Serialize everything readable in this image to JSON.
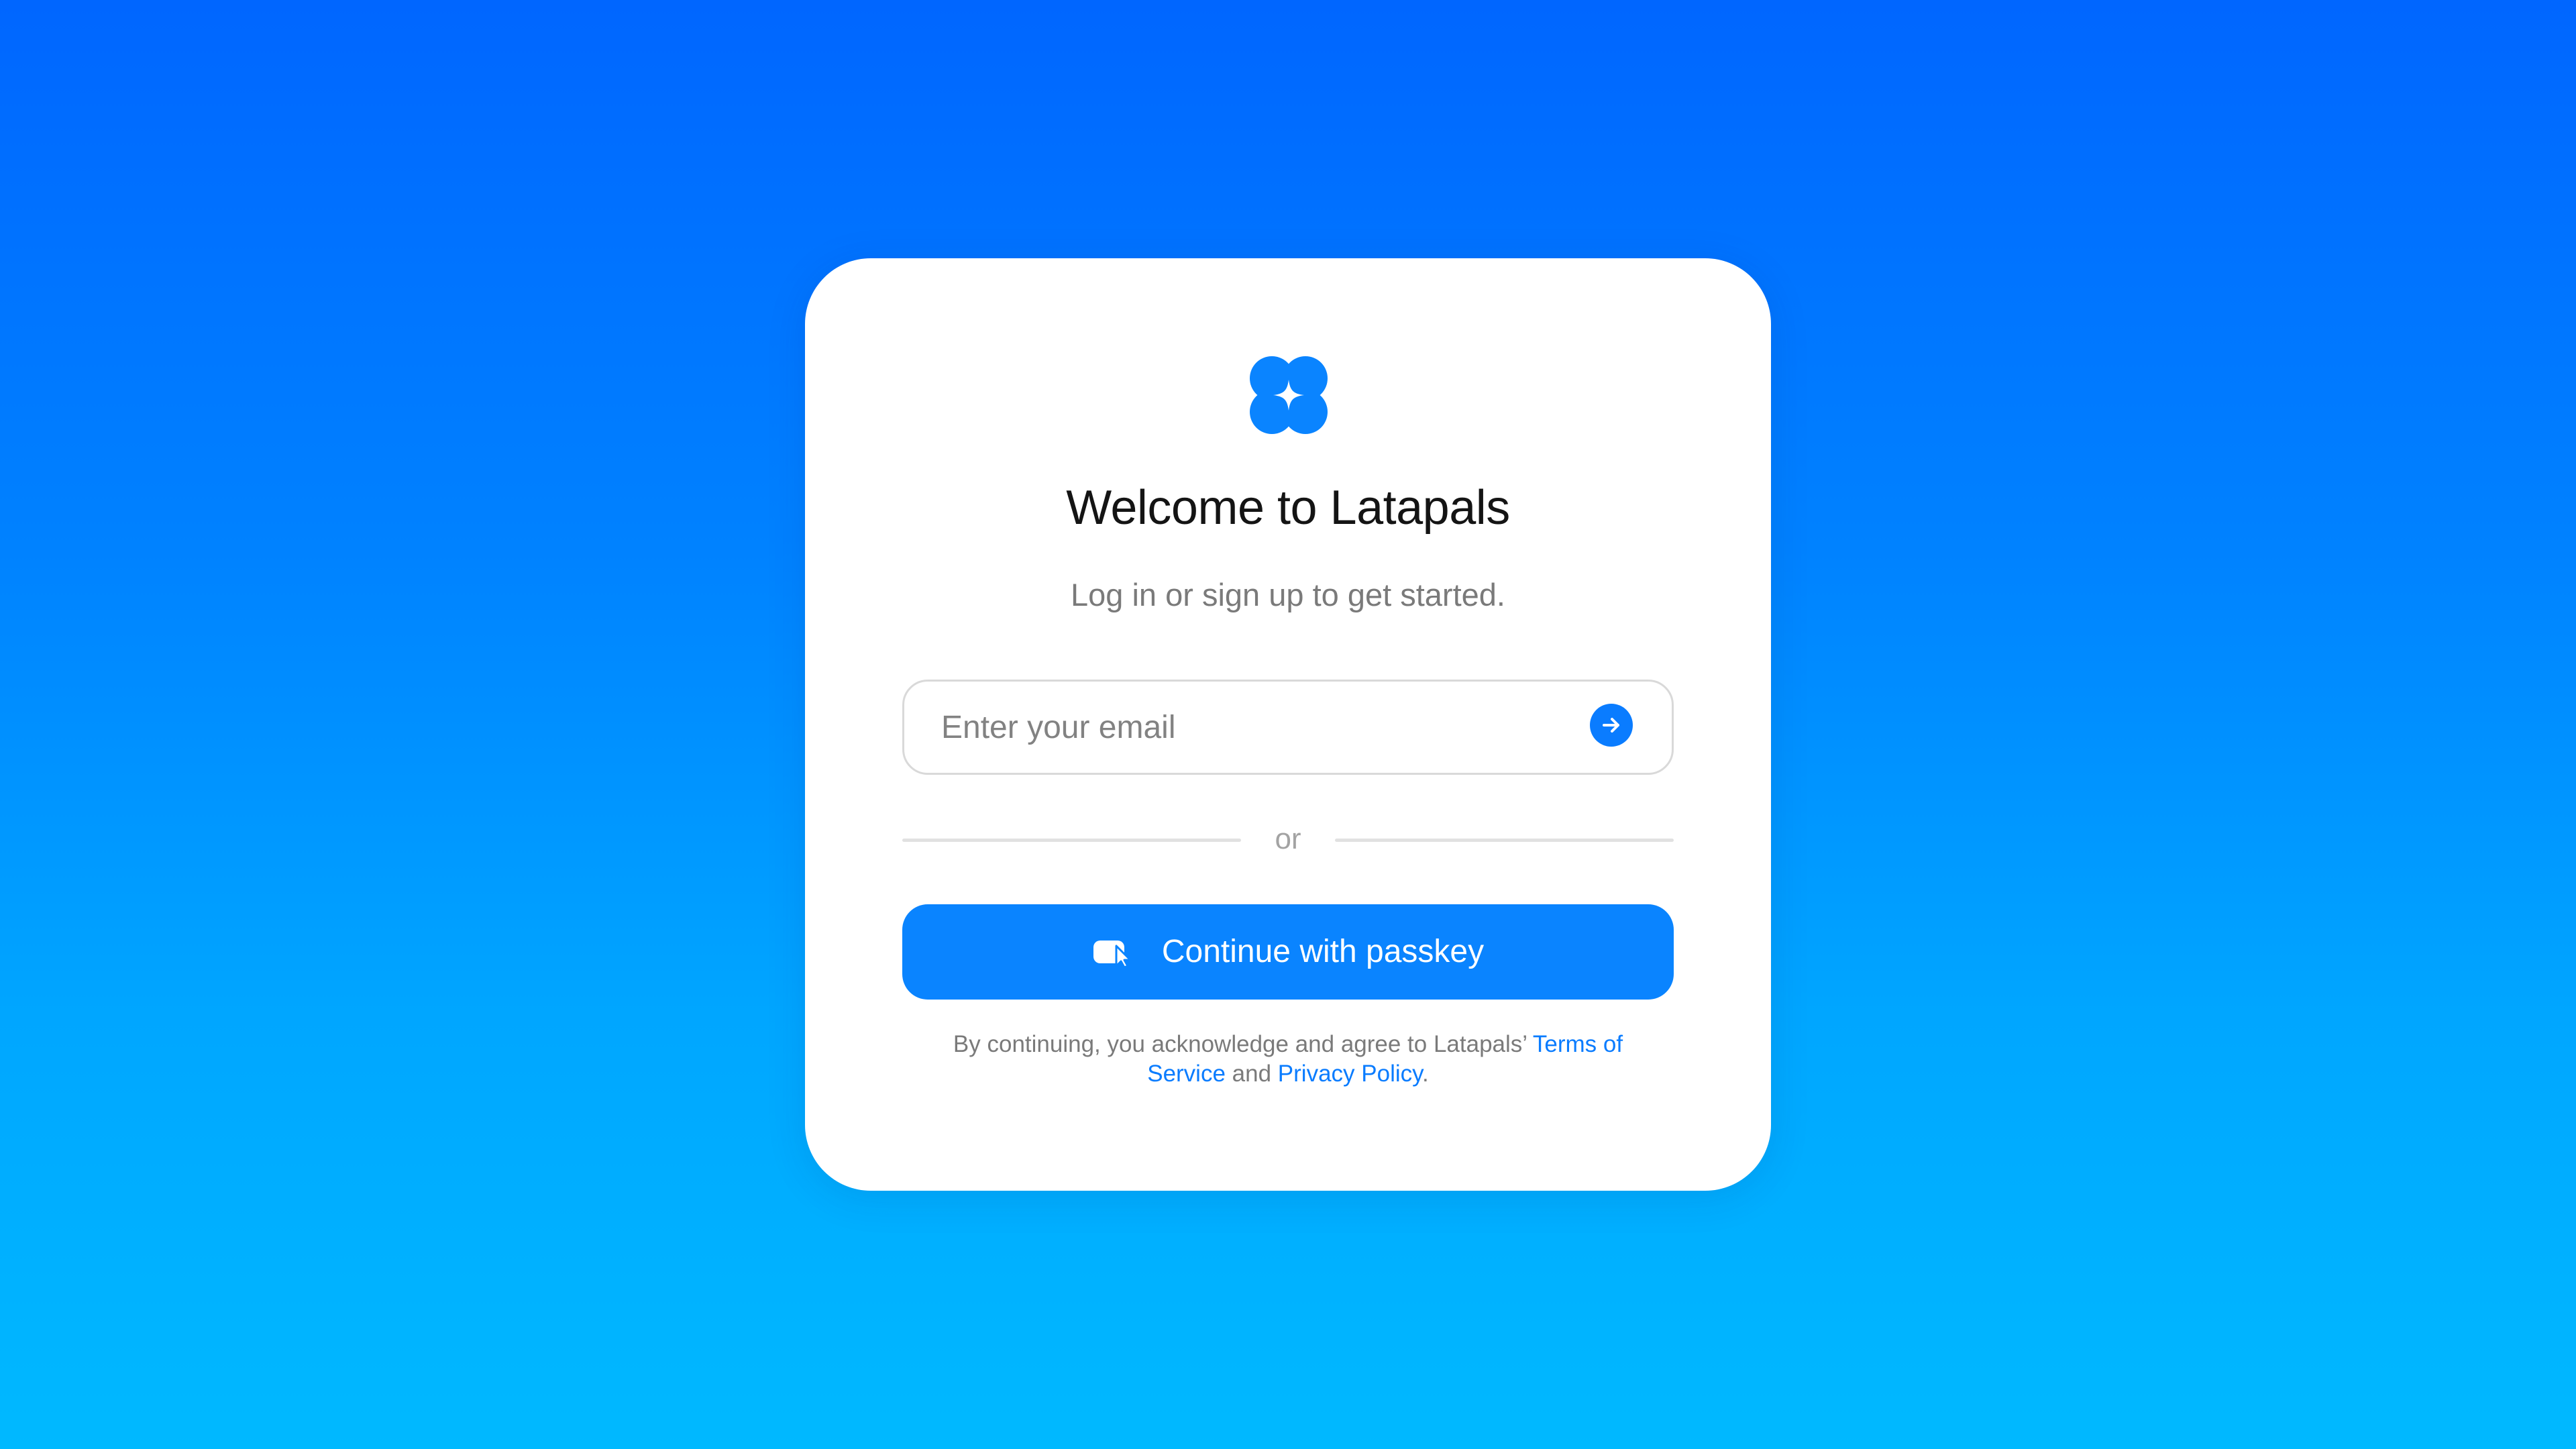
{
  "colors": {
    "background_top": "#0066ff",
    "background_bottom": "#00b9ff",
    "card": "#ffffff",
    "accent": "#0a84ff",
    "title": "#141414",
    "muted_text": "#7a7a7a",
    "link": "#0a7cff"
  },
  "logo": {
    "icon": "clover-sparkle-logo"
  },
  "header": {
    "title": "Welcome to Latapals",
    "subtitle": "Log in or sign up to get started."
  },
  "email": {
    "placeholder": "Enter your email",
    "value": "",
    "submit_icon": "arrow-right-icon"
  },
  "divider": {
    "label": "or"
  },
  "passkey": {
    "label": "Continue with passkey",
    "icon": "passkey-icon"
  },
  "legal": {
    "prefix": "By continuing, you acknowledge and agree to Latapals’ ",
    "terms": "Terms of Service",
    "middle": " and ",
    "privacy": "Privacy Policy",
    "suffix": "."
  }
}
